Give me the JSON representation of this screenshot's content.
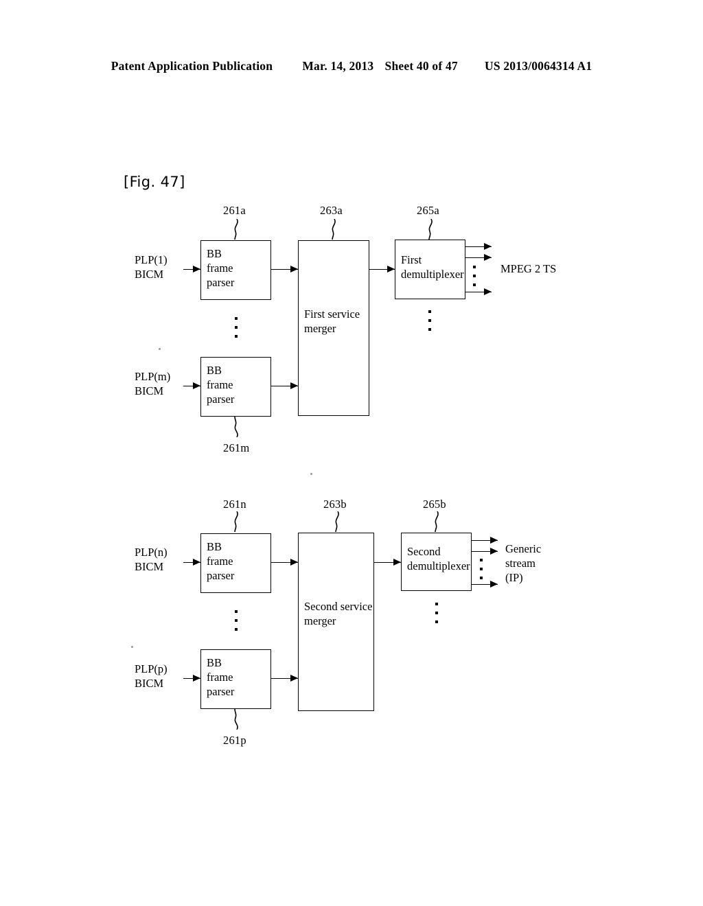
{
  "header": {
    "publication": "Patent Application Publication",
    "date": "Mar. 14, 2013",
    "sheet": "Sheet 40 of 47",
    "patent_number": "US 2013/0064314 A1"
  },
  "figure": {
    "label": "[Fig. 47]"
  },
  "diagram": {
    "top_section": {
      "inputs": [
        {
          "label": "PLP(1)\nBICM"
        },
        {
          "label": "PLP(m)\nBICM"
        }
      ],
      "parsers": [
        {
          "label": "BB\nframe\nparser",
          "ref": "261a"
        },
        {
          "label": "BB\nframe\nparser",
          "ref": "261m"
        }
      ],
      "merger": {
        "label": "First service\nmerger",
        "ref": "263a"
      },
      "demultiplexer": {
        "label": "First\ndemultiplexer",
        "ref": "265a"
      },
      "output": {
        "label": "MPEG 2 TS"
      }
    },
    "bottom_section": {
      "inputs": [
        {
          "label": "PLP(n)\nBICM"
        },
        {
          "label": "PLP(p)\nBICM"
        }
      ],
      "parsers": [
        {
          "label": "BB\nframe\nparser",
          "ref": "261n"
        },
        {
          "label": "BB\nframe\nparser",
          "ref": "261p"
        }
      ],
      "merger": {
        "label": "Second service\nmerger",
        "ref": "263b"
      },
      "demultiplexer": {
        "label": "Second\ndemultiplexer",
        "ref": "265b"
      },
      "output": {
        "label": "Generic\nstream\n(IP)"
      }
    }
  }
}
